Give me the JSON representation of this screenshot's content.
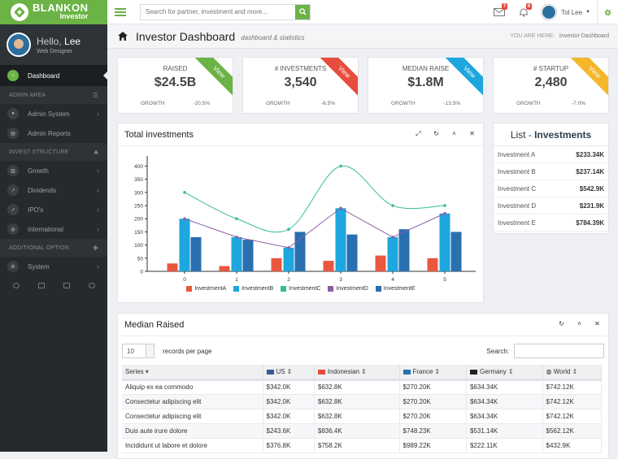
{
  "brand": {
    "name": "BLANKON",
    "sub": "Investor"
  },
  "search": {
    "placeholder": "Search for partner, investment and more..."
  },
  "notifications": {
    "messages": "7",
    "alerts": "6"
  },
  "user": {
    "name": "Tol Lee"
  },
  "profile": {
    "hello": "Hello,",
    "name": "Lee",
    "role": "Web Designer"
  },
  "sidebar": {
    "dashboard": "Dashboard",
    "section_admin": "ADMIN AREA",
    "admin_system": "Admin System",
    "admin_reports": "Admin Reports",
    "section_invest": "INVEST STRUCTURE",
    "growth": "Growth",
    "dividends": "Dividends",
    "ipos": "IPO's",
    "international": "International",
    "section_additional": "ADDITIONAL OPTION",
    "system": "System"
  },
  "page": {
    "title": "Investor Dashboard",
    "subtitle": "dashboard & statistics",
    "you_are_here": "YOU ARE HERE:",
    "crumb": "Investor Dashboard"
  },
  "stats": [
    {
      "label": "RAISED",
      "value": "$24.5B",
      "foot_label": "GROWTH",
      "foot_value": "-20.5%",
      "ribbon": "View",
      "color": "#6ab344"
    },
    {
      "label": "# INVESTMENTS",
      "value": "3,540",
      "foot_label": "GROWTH",
      "foot_value": "-6.5%",
      "ribbon": "View",
      "color": "#e74c3c"
    },
    {
      "label": "MEDIAN RAISE",
      "value": "$1.8M",
      "foot_label": "GROWTH",
      "foot_value": "-13.5%",
      "ribbon": "View",
      "color": "#1ea6de"
    },
    {
      "label": "# STARTUP",
      "value": "2,480",
      "foot_label": "GROWTH",
      "foot_value": "-7.0%",
      "ribbon": "View",
      "color": "#f5b62a"
    }
  ],
  "chart_panel": {
    "title": "Total investments"
  },
  "chart_data": {
    "type": "bar",
    "categories": [
      "0",
      "1",
      "2",
      "3",
      "4",
      "5"
    ],
    "ylim": [
      0,
      420
    ],
    "yticks": [
      "0",
      "50",
      "100",
      "150",
      "200",
      "250",
      "300",
      "350",
      "400"
    ],
    "series": [
      {
        "name": "InvestmentA",
        "type": "bar",
        "color": "#e9573f",
        "values": [
          30,
          20,
          50,
          40,
          60,
          50
        ]
      },
      {
        "name": "InvestmentB",
        "type": "bar",
        "color": "#1ea6de",
        "values": [
          200,
          130,
          90,
          240,
          130,
          220
        ]
      },
      {
        "name": "InvestmentC",
        "type": "line",
        "color": "#37bc9b",
        "values": [
          300,
          200,
          160,
          400,
          250,
          250
        ]
      },
      {
        "name": "InvestmentD",
        "type": "line",
        "color": "#8e5ea2",
        "values": [
          200,
          130,
          90,
          240,
          130,
          220
        ]
      },
      {
        "name": "InvestmentE",
        "type": "bar",
        "color": "#2a6fb0",
        "values": [
          130,
          120,
          150,
          140,
          160,
          150
        ]
      }
    ]
  },
  "list": {
    "title_plain": "List - ",
    "title_bold": "Investments",
    "items": [
      {
        "name": "Investment A",
        "value": "$233.34K"
      },
      {
        "name": "Investment B",
        "value": "$237.14K"
      },
      {
        "name": "Investment C",
        "value": "$542.9K"
      },
      {
        "name": "Investment D",
        "value": "$231.9K"
      },
      {
        "name": "Investment E",
        "value": "$784.39K"
      }
    ]
  },
  "median": {
    "title": "Median Raised",
    "page_size": "10",
    "records_label": "records per page",
    "search_label": "Search:",
    "columns": [
      "Series",
      "US",
      "Indonesian",
      "France",
      "Germany",
      "World"
    ],
    "rows": [
      [
        "Aliquip ex ea commodo",
        "$342.0K",
        "$632.8K",
        "$270.20K",
        "$634.34K",
        "$742.12K"
      ],
      [
        "Consectetur adipiscing elit",
        "$342.0K",
        "$632.8K",
        "$270.20K",
        "$634.34K",
        "$742.12K"
      ],
      [
        "Consectetur adipiscing elit",
        "$342.0K",
        "$632.8K",
        "$270.20K",
        "$634.34K",
        "$742.12K"
      ],
      [
        "Duis aute irure dolore",
        "$243.6K",
        "$836.4K",
        "$748.23K",
        "$531.14K",
        "$562.12K"
      ],
      [
        "Incididunt ut labore et dolore",
        "$376.8K",
        "$758.2K",
        "$989.22K",
        "$222.11K",
        "$432.9K"
      ]
    ]
  }
}
